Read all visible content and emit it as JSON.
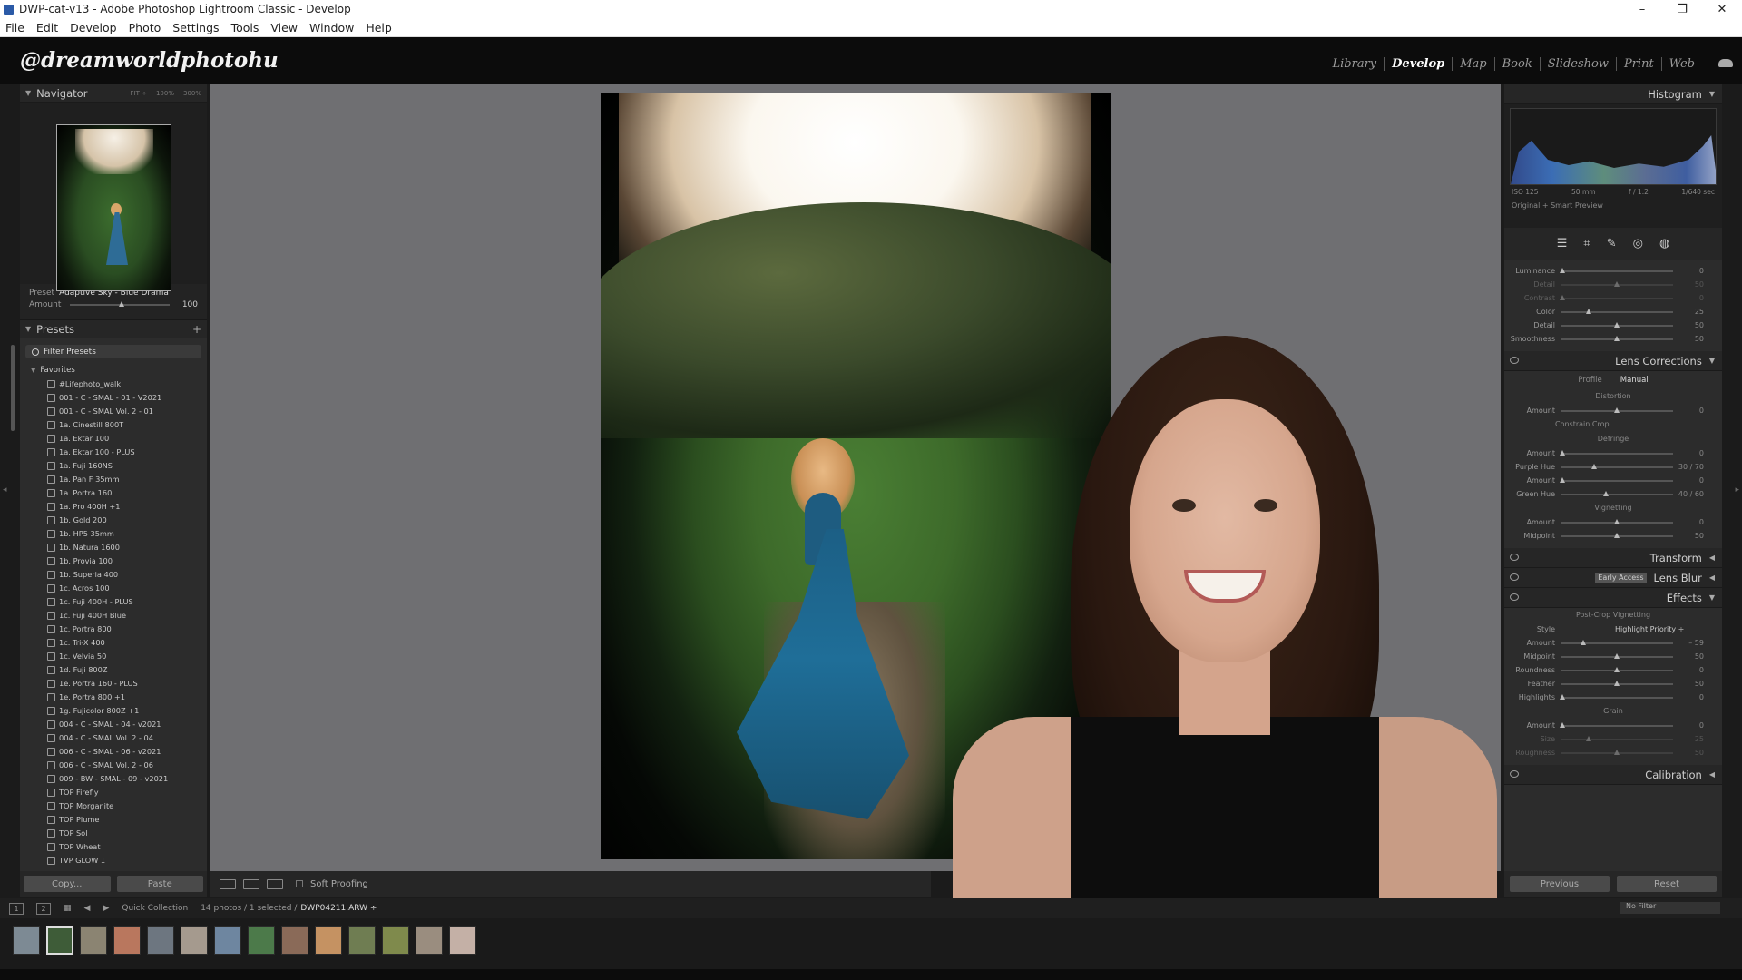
{
  "window": {
    "title": "DWP-cat-v13 - Adobe Photoshop Lightroom Classic - Develop",
    "controls": [
      "–",
      "❐",
      "✕"
    ]
  },
  "menu": [
    "File",
    "Edit",
    "Develop",
    "Photo",
    "Settings",
    "Tools",
    "View",
    "Window",
    "Help"
  ],
  "identity_plate": "@dreamworldphotohu",
  "modules": [
    "Library",
    "Develop",
    "Map",
    "Book",
    "Slideshow",
    "Print",
    "Web"
  ],
  "active_module": "Develop",
  "navigator": {
    "title": "Navigator",
    "zoom": [
      "FIT ÷",
      "100%",
      "300%"
    ]
  },
  "preset_box": {
    "label": "Preset",
    "name": "Adaptive Sky - Blue Drama",
    "amount_label": "Amount",
    "amount": "100"
  },
  "presets": {
    "title": "Presets",
    "filter_label": "Filter Presets",
    "group": "Favorites",
    "items": [
      "#Lifephoto_walk",
      "001 - C - SMAL - 01 - V2021",
      "001 - C - SMAL Vol. 2 - 01",
      "1a. Cinestill 800T",
      "1a. Ektar 100",
      "1a. Ektar 100 - PLUS",
      "1a. Fuji 160NS",
      "1a. Pan F 35mm",
      "1a. Portra 160",
      "1a. Pro 400H +1",
      "1b. Gold 200",
      "1b. HP5 35mm",
      "1b. Natura 1600",
      "1b. Provia 100",
      "1b. Superia 400",
      "1c. Acros 100",
      "1c. Fuji 400H - PLUS",
      "1c. Fuji 400H Blue",
      "1c. Portra 800",
      "1c. Tri-X 400",
      "1c. Velvia 50",
      "1d. Fuji 800Z",
      "1e. Portra 160 - PLUS",
      "1e. Portra 800 +1",
      "1g. Fujicolor 800Z +1",
      "004 - C - SMAL - 04 - v2021",
      "004 - C - SMAL Vol. 2 - 04",
      "006 - C - SMAL - 06 - v2021",
      "006 - C - SMAL Vol. 2 - 06",
      "009 - BW - SMAL - 09 - v2021",
      "TOP Firefly",
      "TOP Morganite",
      "TOP Plume",
      "TOP Sol",
      "TOP Wheat",
      "TVP GLOW 1"
    ]
  },
  "left_buttons": {
    "copy": "Copy...",
    "paste": "Paste"
  },
  "toolbar": {
    "soft_proofing": "Soft Proofing"
  },
  "histogram": {
    "title": "Histogram",
    "info": [
      "ISO 125",
      "50 mm",
      "f / 1.2",
      "1/640 sec"
    ],
    "preview": "Original + Smart Preview"
  },
  "detail_sliders": [
    {
      "label": "Luminance",
      "value": "0",
      "pos": 0.02,
      "dim": false
    },
    {
      "label": "Detail",
      "value": "50",
      "pos": 0.5,
      "dim": true
    },
    {
      "label": "Contrast",
      "value": "0",
      "pos": 0.02,
      "dim": true
    },
    {
      "label": "Color",
      "value": "25",
      "pos": 0.25,
      "dim": false
    },
    {
      "label": "Detail",
      "value": "50",
      "pos": 0.5,
      "dim": false
    },
    {
      "label": "Smoothness",
      "value": "50",
      "pos": 0.5,
      "dim": false
    }
  ],
  "lens": {
    "title": "Lens Corrections",
    "tabs": [
      "Profile",
      "Manual"
    ],
    "distortion_title": "Distortion",
    "distortion_amount": {
      "label": "Amount",
      "value": "0",
      "pos": 0.5
    },
    "constrain_crop": "Constrain Crop",
    "defringe_title": "Defringe",
    "defringe": [
      {
        "label": "Amount",
        "value": "0",
        "pos": 0.02
      },
      {
        "label": "Purple Hue",
        "value": "30 / 70",
        "pos": 0.3
      },
      {
        "label": "Amount",
        "value": "0",
        "pos": 0.02
      },
      {
        "label": "Green Hue",
        "value": "40 / 60",
        "pos": 0.4
      }
    ],
    "vignetting_title": "Vignetting",
    "vignetting": [
      {
        "label": "Amount",
        "value": "0",
        "pos": 0.5
      },
      {
        "label": "Midpoint",
        "value": "50",
        "pos": 0.5
      }
    ]
  },
  "panels": {
    "transform": "Transform",
    "lens_blur": "Lens Blur",
    "early_access": "Early Access",
    "effects": "Effects",
    "calibration": "Calibration"
  },
  "effects": {
    "post_crop_title": "Post-Crop Vignetting",
    "style_label": "Style",
    "style_value": "Highlight Priority ÷",
    "sliders": [
      {
        "label": "Amount",
        "value": "– 59",
        "pos": 0.2
      },
      {
        "label": "Midpoint",
        "value": "50",
        "pos": 0.5
      },
      {
        "label": "Roundness",
        "value": "0",
        "pos": 0.5
      },
      {
        "label": "Feather",
        "value": "50",
        "pos": 0.5
      },
      {
        "label": "Highlights",
        "value": "0",
        "pos": 0.02
      }
    ],
    "grain_title": "Grain",
    "grain": [
      {
        "label": "Amount",
        "value": "0",
        "pos": 0.02,
        "dim": false
      },
      {
        "label": "Size",
        "value": "25",
        "pos": 0.25,
        "dim": true
      },
      {
        "label": "Roughness",
        "value": "50",
        "pos": 0.5,
        "dim": true
      }
    ]
  },
  "right_buttons": {
    "previous": "Previous",
    "reset": "Reset"
  },
  "filmstrip": {
    "pages": [
      "1",
      "2"
    ],
    "source": "Quick Collection",
    "count": "14 photos / 1 selected /",
    "filename": "DWP04211.ARW ÷",
    "filter": "No Filter",
    "thumb_count": 14,
    "selected_index": 1
  }
}
